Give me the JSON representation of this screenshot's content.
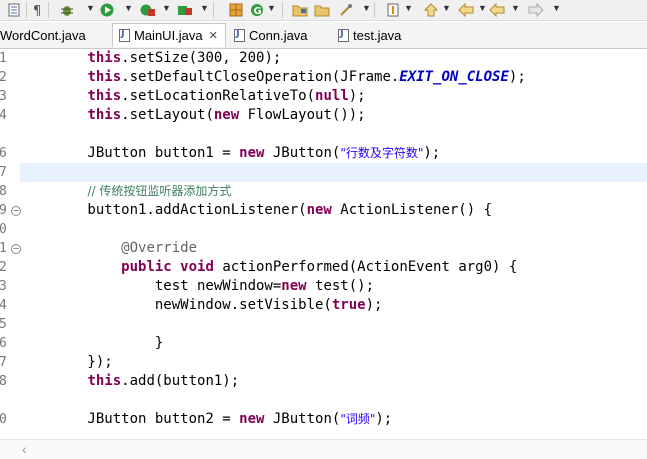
{
  "toolbar": {
    "icons": [
      "outline-icon",
      "paragraph-icon",
      "debug-icon",
      "run-icon",
      "coverage-icon",
      "external-tools-icon",
      "new-class-icon",
      "refresh-icon",
      "open-type-icon",
      "open-folder-icon",
      "search-icon",
      "annotation-next-icon",
      "annotation-prev-icon",
      "last-edit-icon",
      "back-icon",
      "forward-icon"
    ]
  },
  "tabs": [
    {
      "label": "WordCont.java",
      "active": false
    },
    {
      "label": "MainUI.java",
      "active": true,
      "close": "✕"
    },
    {
      "label": "Conn.java",
      "active": false
    },
    {
      "label": "test.java",
      "active": false
    }
  ],
  "gutter": {
    "line_numbers": [
      "1",
      "2",
      "3",
      "4",
      "",
      "6",
      "7",
      "8",
      "9",
      "0",
      "1",
      "2",
      "3",
      "4",
      "5",
      "6",
      "7",
      "8",
      "",
      "0"
    ]
  },
  "code": {
    "l1": {
      "a": "        ",
      "kw": "this",
      "b": ".setSize(300, 200);"
    },
    "l2": {
      "a": "        ",
      "kw": "this",
      "b": ".setDefaultCloseOperation(JFrame.",
      "fld": "EXIT_ON_CLOSE",
      "c": ");"
    },
    "l3": {
      "a": "        ",
      "kw": "this",
      "b": ".setLocationRelativeTo(",
      "kw2": "null",
      "c": ");"
    },
    "l4": {
      "a": "        ",
      "kw": "this",
      "b": ".setLayout(",
      "kw2": "new",
      "c": " FlowLayout());"
    },
    "l6": {
      "a": "        JButton button1 = ",
      "kw": "new",
      "b": " JButton(",
      "str": "\"行数及字符数\"",
      "c": ");"
    },
    "l8": {
      "a": "        ",
      "cm": "// 传统按钮监听器添加方式"
    },
    "l9": {
      "a": "        button1.addActionListener(",
      "kw": "new",
      "b": " ActionListener() {"
    },
    "l11": {
      "a": "            ",
      "ann": "@Override"
    },
    "l12": {
      "a": "            ",
      "kw": "public",
      "b": " ",
      "kw2": "void",
      "c": " actionPerformed(ActionEvent arg0) {"
    },
    "l13": {
      "a": "                test newWindow=",
      "kw": "new",
      "b": " test();"
    },
    "l14": {
      "a": "                newWindow.setVisible(",
      "kw": "true",
      "b": ");"
    },
    "l16": {
      "a": "                }"
    },
    "l17": {
      "a": "        });"
    },
    "l18": {
      "a": "        ",
      "kw": "this",
      "b": ".add(button1);"
    },
    "l20": {
      "a": "        JButton button2 = ",
      "kw": "new",
      "b": " JButton(",
      "str": "\"词频\"",
      "c": ");"
    }
  },
  "colors": {
    "keyword": "#7f0055",
    "string": "#2a00ff",
    "comment": "#3f7f5f",
    "field": "#0000c0",
    "current_line": "#e8f2fe"
  }
}
